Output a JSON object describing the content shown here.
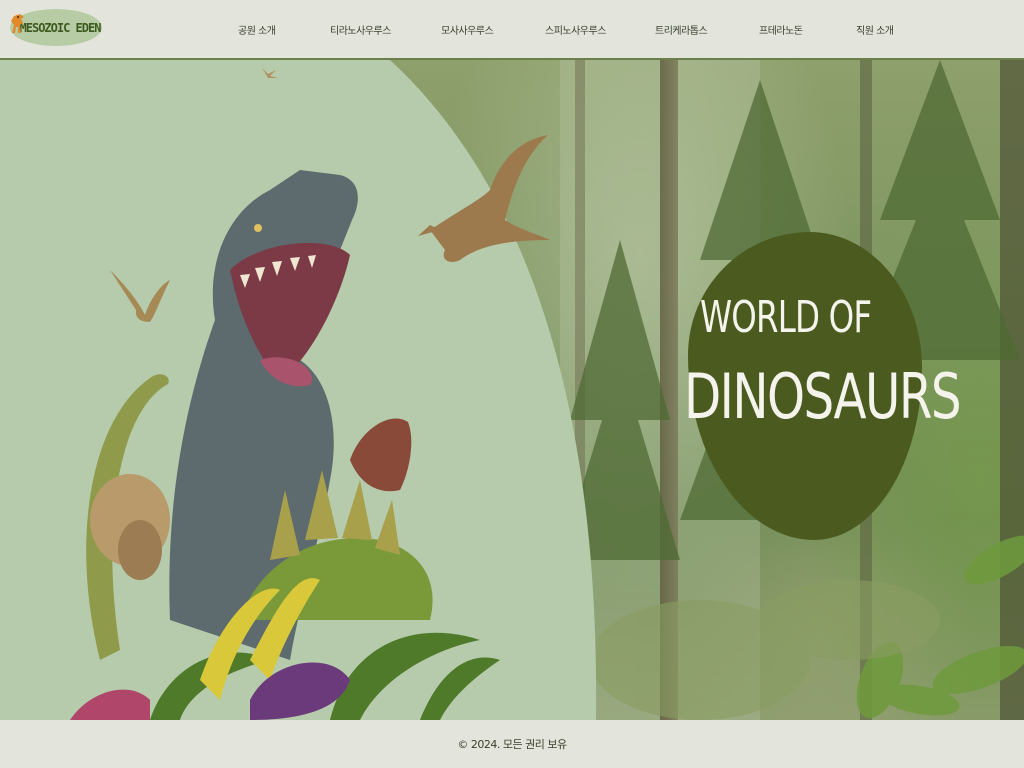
{
  "brand": {
    "logo_text": "MESOZOIC EDEN",
    "logo_bg": "#b7cba5",
    "logo_text_color": "#3d5a1e"
  },
  "nav": {
    "items": [
      {
        "label": "공원 소개"
      },
      {
        "label": "티라노사우루스"
      },
      {
        "label": "모사사우루스"
      },
      {
        "label": "스피노사우루스"
      },
      {
        "label": "트리케라톱스"
      },
      {
        "label": "프테라노돈"
      },
      {
        "label": "직원 소개"
      }
    ]
  },
  "hero": {
    "title_line1": "WORLD OF",
    "title_line2": "DINOSAURS",
    "panel_color": "#b5cbab",
    "blob_color": "#4b5b1f"
  },
  "footer": {
    "copyright": "© 2024. 모든 권리 보유"
  },
  "icons": [
    "dinosaur-logo-icon"
  ]
}
